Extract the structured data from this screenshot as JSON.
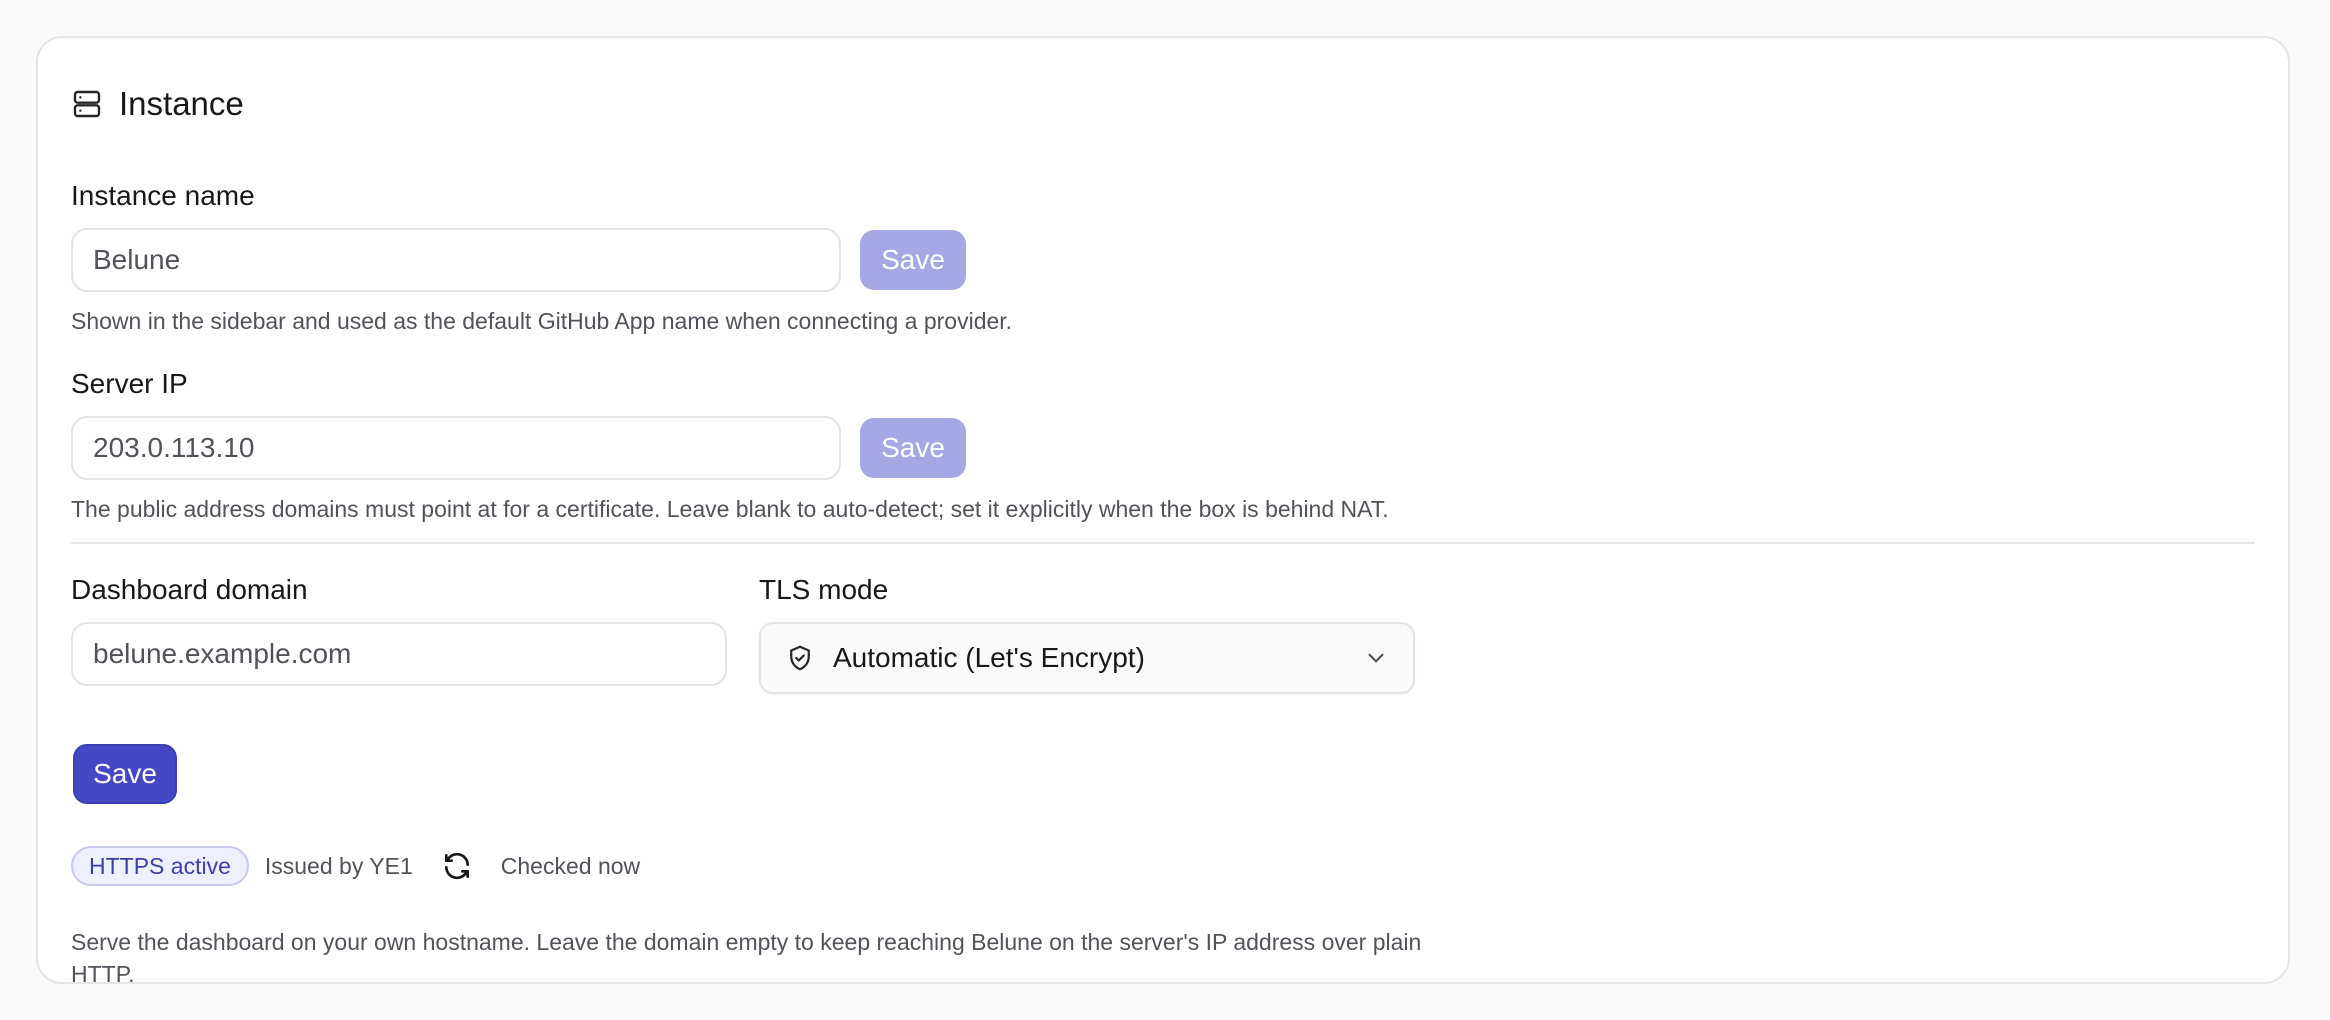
{
  "card": {
    "title": "Instance",
    "icon": "server-icon"
  },
  "instance_name": {
    "label": "Instance name",
    "value": "Belune",
    "save_label": "Save",
    "help": "Shown in the sidebar and used as the default GitHub App name when connecting a provider."
  },
  "server_ip": {
    "label": "Server IP",
    "value": "203.0.113.10",
    "save_label": "Save",
    "help": "The public address domains must point at for a certificate. Leave blank to auto-detect; set it explicitly when the box is behind NAT."
  },
  "dashboard_domain": {
    "label": "Dashboard domain",
    "value": "belune.example.com"
  },
  "tls_mode": {
    "label": "TLS mode",
    "selected": "Automatic (Let's Encrypt)",
    "icon": "shield-check-icon"
  },
  "save_button": "Save",
  "status": {
    "badge": "HTTPS active",
    "issued": "Issued by YE1",
    "checked": "Checked now"
  },
  "footer_help": "Serve the dashboard on your own hostname. Leave the domain empty to keep reaching Belune on the server's IP address over plain HTTP.",
  "colors": {
    "primary": "#4448c4",
    "primary_muted": "#a5a8e4",
    "badge_bg": "#eef0fd",
    "badge_text": "#3c3fa6"
  }
}
